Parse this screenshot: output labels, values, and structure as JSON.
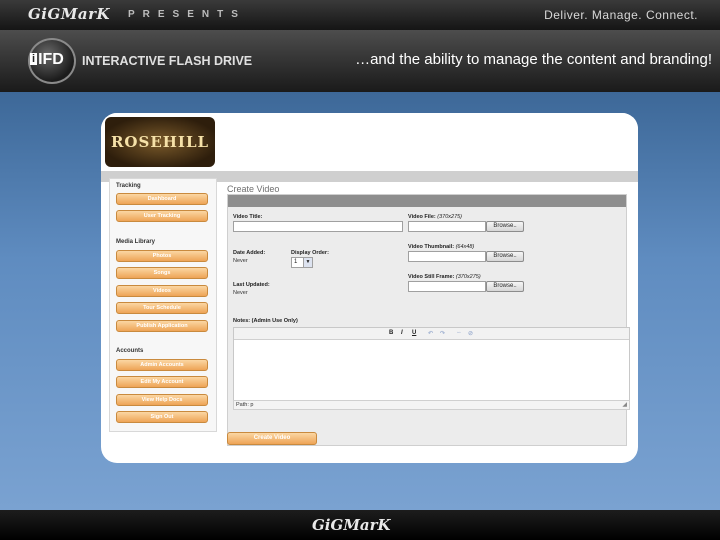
{
  "header": {
    "logo": "GiGMarK",
    "presents": "PRESENTS",
    "tagline": "Deliver.  Manage.  Connect."
  },
  "product": {
    "badge_b": "i",
    "badge_ifd": "IFD",
    "title": "INTERACTIVE FLASH DRIVE",
    "headline": "…and the ability to manage the content and branding!"
  },
  "brand": {
    "logo_text": "ROSEHILL"
  },
  "sidebar": {
    "sections": [
      {
        "title": "Tracking",
        "items": [
          "Dashboard",
          "User Tracking"
        ]
      },
      {
        "title": "Media Library",
        "items": [
          "Photos",
          "Songs",
          "Videos",
          "Tour Schedule",
          "Publish Application"
        ]
      },
      {
        "title": "Accounts",
        "items": [
          "Admin Accounts",
          "Edit My Account",
          "View Help Docs",
          "Sign Out"
        ]
      }
    ]
  },
  "form": {
    "page_title": "Create Video",
    "video_title_label": "Video Title:",
    "video_file_label": "Video File:",
    "video_file_hint": "(370x275)",
    "video_thumb_label": "Video Thumbnail:",
    "video_thumb_hint": "(64x48)",
    "video_still_label": "Video Still Frame:",
    "video_still_hint": "(370x275)",
    "date_added_label": "Date Added:",
    "date_added_value": "Never",
    "display_order_label": "Display Order:",
    "display_order_value": "1",
    "last_updated_label": "Last Updated:",
    "last_updated_value": "Never",
    "notes_label": "Notes: (Admin Use Only)",
    "browse_label": "Browse..",
    "path_text": "Path: p",
    "submit_label": "Create Video"
  },
  "editor_toolbar": {
    "bold": "B",
    "italic": "I",
    "underline": "U",
    "undo": "↶",
    "redo": "↷",
    "link": "⇔",
    "unlink": "⊘"
  },
  "footer": {
    "logo": "GiGMarK"
  },
  "colors": {
    "accent_orange": "#eea456",
    "background_blue": "#5f8cc0"
  }
}
